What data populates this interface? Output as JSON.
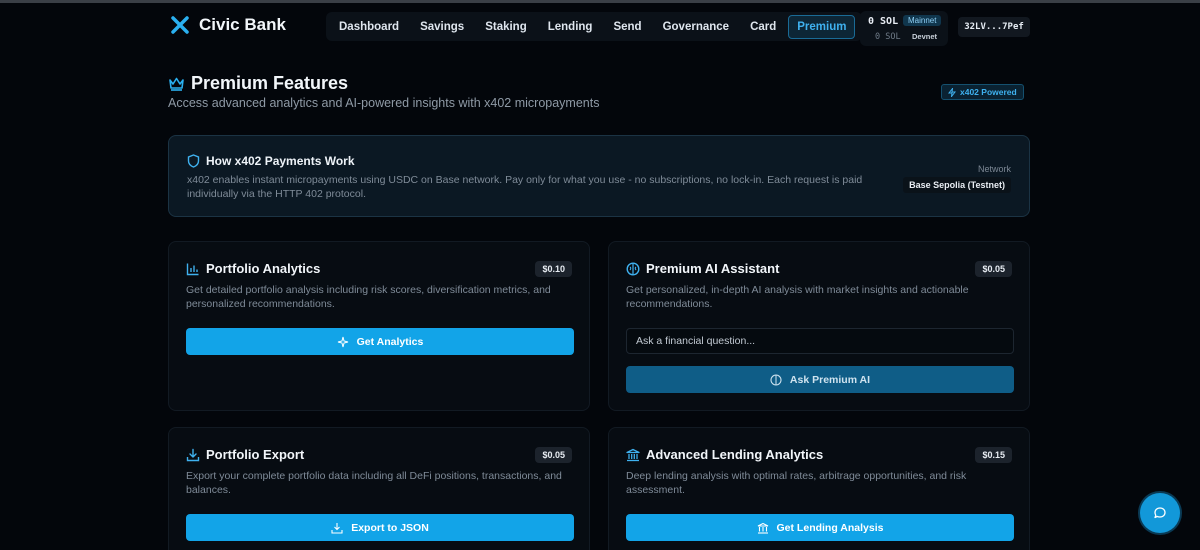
{
  "header": {
    "brand": "Civic Bank",
    "nav": [
      {
        "label": "Dashboard"
      },
      {
        "label": "Savings"
      },
      {
        "label": "Staking"
      },
      {
        "label": "Lending"
      },
      {
        "label": "Send"
      },
      {
        "label": "Governance"
      },
      {
        "label": "Card"
      },
      {
        "label": "Premium",
        "active": true
      }
    ],
    "wallet": {
      "balance": "0 SOL",
      "network_badge": "Mainnet",
      "sub_balance": "0 SOL",
      "sub_network": "Devnet"
    },
    "address": "32LV...7Pef"
  },
  "page": {
    "title": "Premium Features",
    "subtitle": "Access advanced analytics and AI-powered insights with x402 micropayments",
    "badge": "x402 Powered"
  },
  "info": {
    "title": "How x402 Payments Work",
    "text": "x402 enables instant micropayments using USDC on Base network. Pay only for what you use - no subscriptions, no lock-in. Each request is paid individually via the HTTP 402 protocol.",
    "network_label": "Network",
    "network_value": "Base Sepolia (Testnet)"
  },
  "cards": {
    "analytics": {
      "title": "Portfolio Analytics",
      "price": "$0.10",
      "description": "Get detailed portfolio analysis including risk scores, diversification metrics, and personalized recommendations.",
      "button": "Get Analytics"
    },
    "ai": {
      "title": "Premium AI Assistant",
      "price": "$0.05",
      "description": "Get personalized, in-depth AI analysis with market insights and actionable recommendations.",
      "input_placeholder": "Ask a financial question...",
      "button": "Ask Premium AI"
    },
    "export": {
      "title": "Portfolio Export",
      "price": "$0.05",
      "description": "Export your complete portfolio data including all DeFi positions, transactions, and balances.",
      "button": "Export to JSON"
    },
    "lending": {
      "title": "Advanced Lending Analytics",
      "price": "$0.15",
      "description": "Deep lending analysis with optimal rates, arbitrage opportunities, and risk assessment.",
      "button": "Get Lending Analysis"
    }
  },
  "colors": {
    "background": "#03060b",
    "accent": "#12a4e8",
    "accent_dim": "#0f5d87",
    "card": "#070c12"
  },
  "icons": {
    "brand": "civic-logo-icon",
    "title": "crown-icon",
    "badge": "lightning-icon",
    "info": "shield-icon",
    "analytics": "bar-chart-icon",
    "ai": "brain-icon",
    "export": "download-icon",
    "lending": "bank-icon",
    "chat": "chat-bubble-icon"
  }
}
